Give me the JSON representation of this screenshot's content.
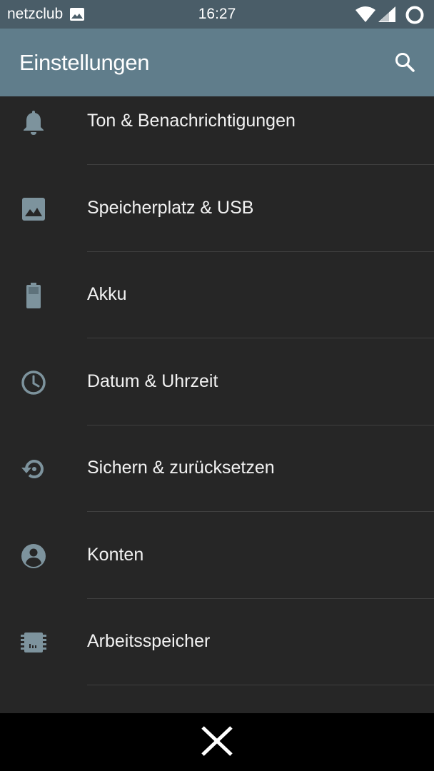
{
  "status_bar": {
    "carrier": "netzclub",
    "time": "16:27",
    "icons": [
      "image-notification-icon",
      "wifi-icon",
      "signal-icon",
      "sync-icon"
    ]
  },
  "app_bar": {
    "title": "Einstellungen",
    "action_icon": "search-icon"
  },
  "settings_items": [
    {
      "label": "Ton & Benachrichtigungen",
      "icon": "bell-icon"
    },
    {
      "label": "Speicherplatz & USB",
      "icon": "storage-image-icon"
    },
    {
      "label": "Akku",
      "icon": "battery-icon"
    },
    {
      "label": "Datum & Uhrzeit",
      "icon": "clock-icon"
    },
    {
      "label": "Sichern & zurücksetzen",
      "icon": "restore-icon"
    },
    {
      "label": "Konten",
      "icon": "account-icon"
    },
    {
      "label": "Arbeitsspeicher",
      "icon": "memory-chip-icon"
    }
  ],
  "nav_bar": {
    "icon": "close-icon"
  },
  "colors": {
    "status_bar": "#4a5d68",
    "app_bar": "#607d8b",
    "background": "#262626",
    "icon": "#7d939d",
    "text": "#f2f2f2",
    "divider": "#3f3f3f",
    "nav_bar": "#000000"
  }
}
